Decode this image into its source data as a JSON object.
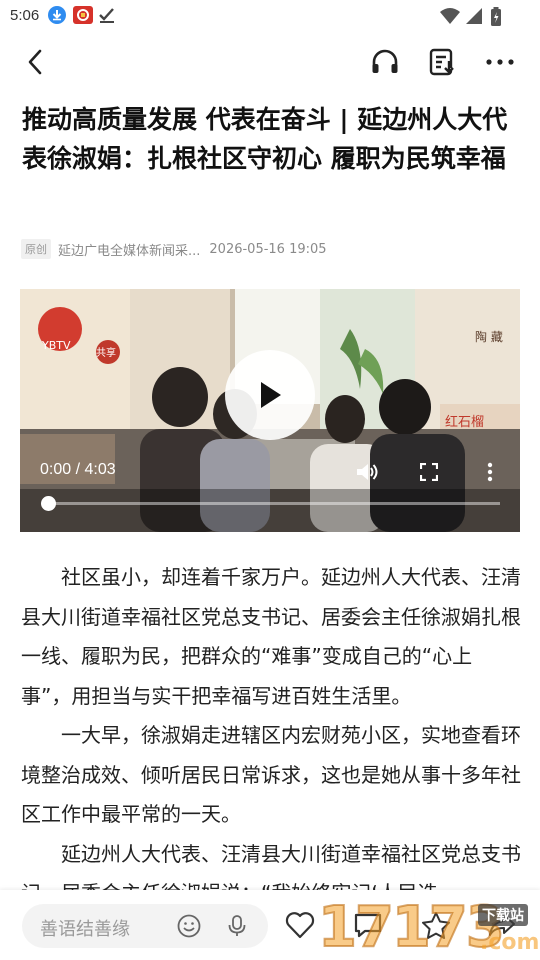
{
  "status_bar": {
    "time": "5:06",
    "left_icons": [
      "download-icon",
      "app-notification-icon",
      "check-icon"
    ],
    "right_icons": [
      "wifi-icon",
      "signal-icon",
      "battery-icon"
    ]
  },
  "app_bar": {
    "back_icon": "chevron-left-icon",
    "actions": [
      "headphones-icon",
      "playlist-download-icon",
      "more-icon"
    ]
  },
  "article": {
    "title": "推动高质量发展 代表在奋斗 | 延边州人大代表徐淑娟：扎根社区守初心 履职为民筑幸福",
    "badge": "原创",
    "source": "延边广电全媒体新闻采...",
    "datetime": "2026-05-16 19:05",
    "paragraphs": [
      "社区虽小，却连着千家万户。延边州人大代表、汪清县大川街道幸福社区党总支书记、居委会主任徐淑娟扎根一线、履职为民，把群众的“难事”变成自己的“心上事”，用担当与实干把幸福写进百姓生活里。",
      "一大早，徐淑娟走进辖区内宏财苑小区，实地查看环境整治成效、倾听居民日常诉求，这也是她从事十多年社区工作中最平常的一天。",
      "延边州人大代表、汪清县大川街道幸福社区党总支书记、居委会主任徐淑娟说：“我始终牢记‘人民选"
    ]
  },
  "video": {
    "time_display": "0:00 / 4:03",
    "progress_fraction": 0,
    "controls": [
      "play-icon",
      "volume-icon",
      "fullscreen-icon",
      "more-vertical-icon"
    ],
    "scene_text": {
      "logo_text": "YBTV",
      "sign_share": "共享",
      "sign_right": "陶 藏",
      "sign_red": "红石榴"
    }
  },
  "bottom_bar": {
    "comment_placeholder": "善语结善缘",
    "icons": [
      "emoji-icon",
      "microphone-icon",
      "heart-icon",
      "comment-icon",
      "star-icon",
      "share-icon"
    ]
  },
  "watermark": {
    "number": "17173",
    "suffix": ".com",
    "download_label": "下载站"
  },
  "colors": {
    "text": "#111111",
    "meta": "#8a8a8a",
    "accent_red": "#d23c2f"
  }
}
